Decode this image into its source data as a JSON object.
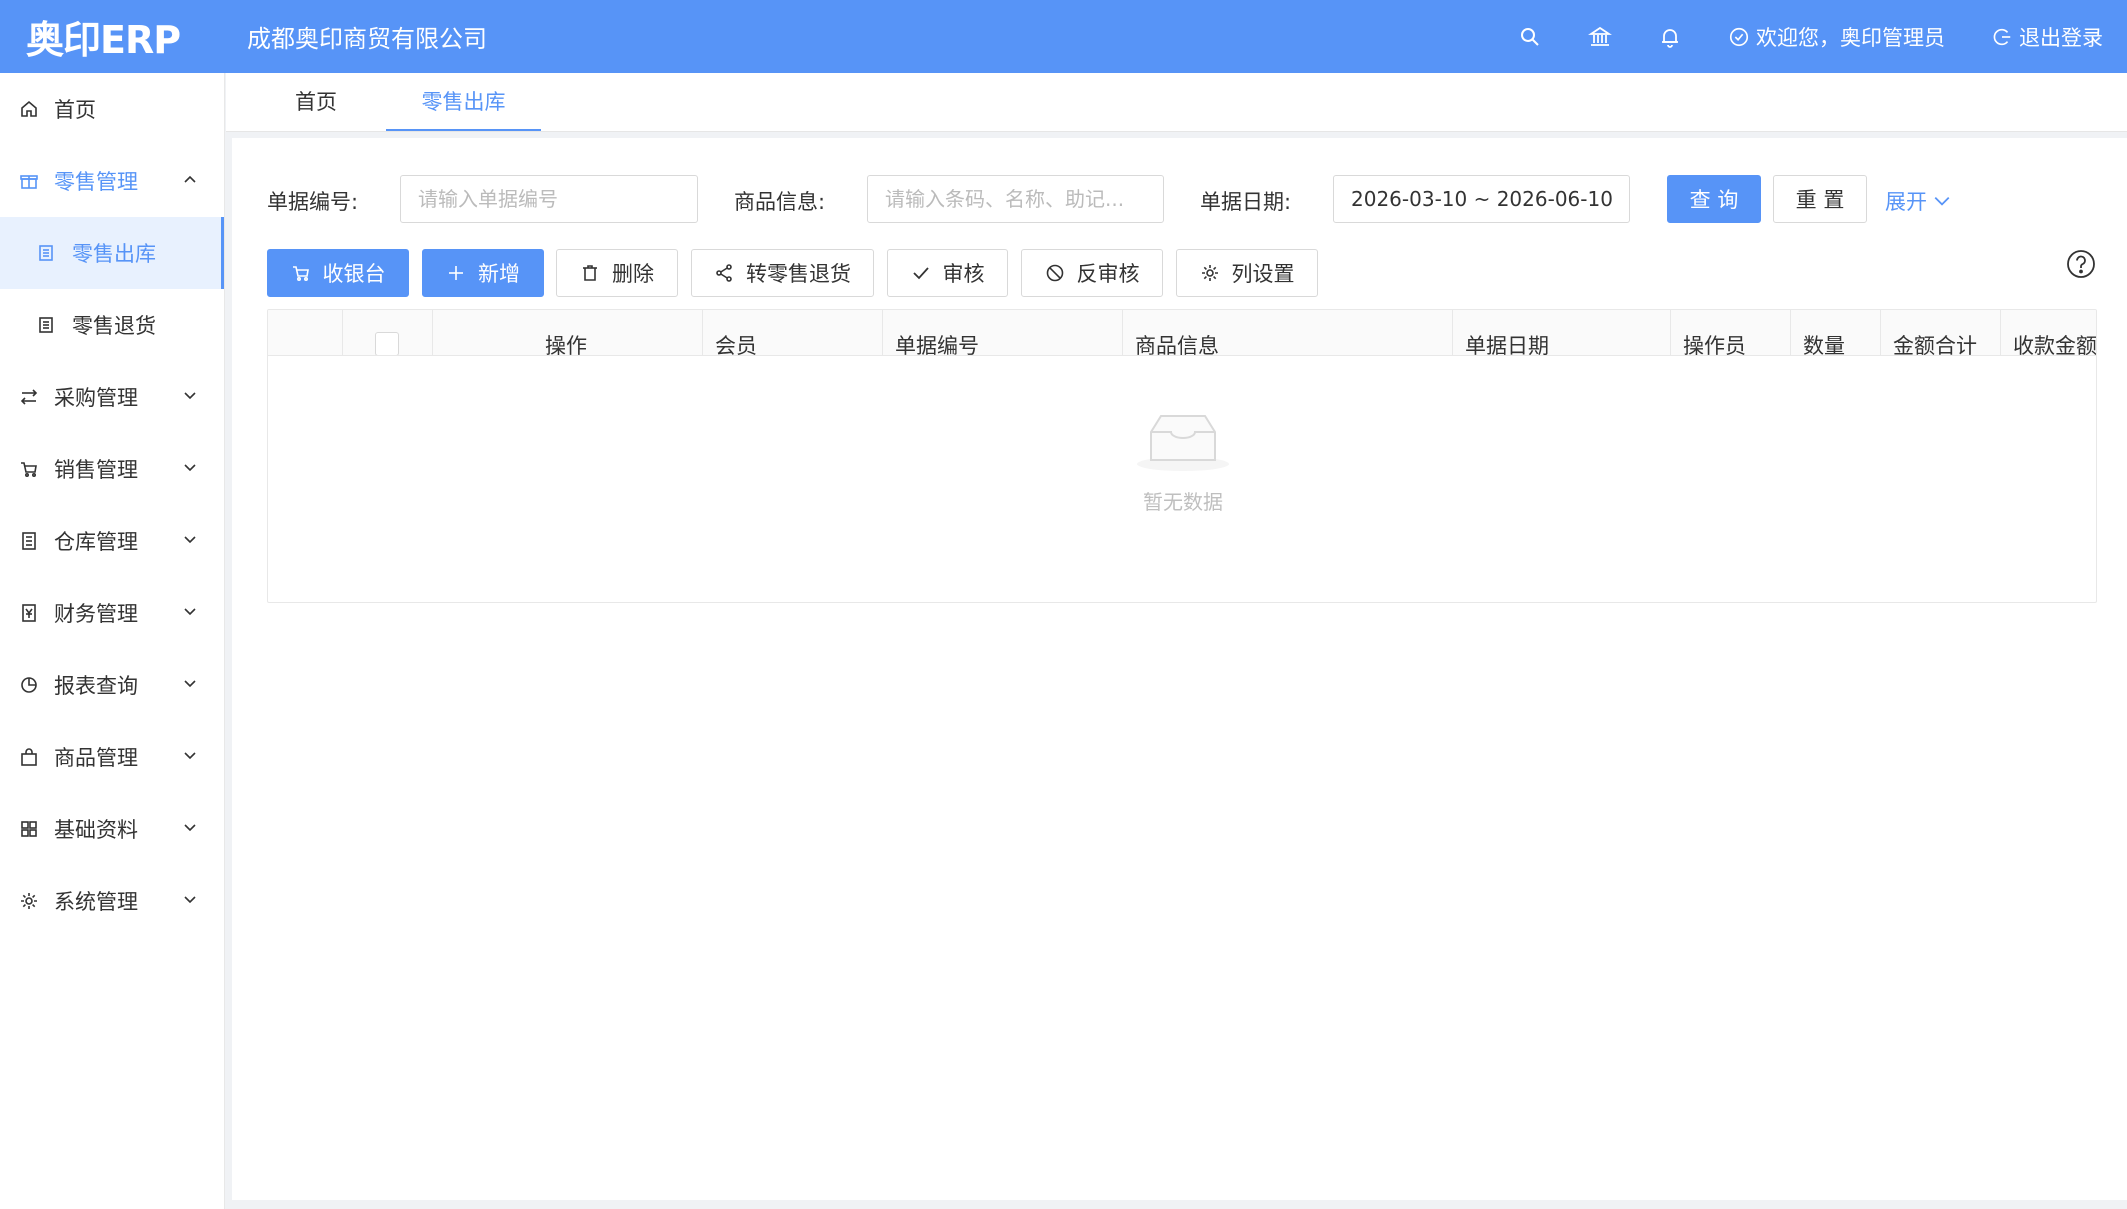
{
  "header": {
    "logo": "奥印ERP",
    "company": "成都奥印商贸有限公司",
    "welcome": "欢迎您，奥印管理员",
    "logout": "退出登录",
    "icons": [
      "search-icon",
      "bank-icon",
      "bell-icon"
    ]
  },
  "sidebar": {
    "items": [
      {
        "label": "首页",
        "icon": "home-icon"
      },
      {
        "label": "零售管理",
        "icon": "gift-icon",
        "expanded": true,
        "children": [
          {
            "label": "零售出库",
            "icon": "document-icon",
            "active": true
          },
          {
            "label": "零售退货",
            "icon": "document-icon"
          }
        ]
      },
      {
        "label": "采购管理",
        "icon": "swap-icon"
      },
      {
        "label": "销售管理",
        "icon": "cart-icon"
      },
      {
        "label": "仓库管理",
        "icon": "warehouse-icon"
      },
      {
        "label": "财务管理",
        "icon": "finance-icon"
      },
      {
        "label": "报表查询",
        "icon": "pie-chart-icon"
      },
      {
        "label": "商品管理",
        "icon": "bag-icon"
      },
      {
        "label": "基础资料",
        "icon": "grid-icon"
      },
      {
        "label": "系统管理",
        "icon": "gear-icon"
      }
    ]
  },
  "tabs": [
    {
      "label": "首页"
    },
    {
      "label": "零售出库",
      "active": true
    }
  ],
  "search": {
    "bill_no_label": "单据编号:",
    "bill_no_placeholder": "请输入单据编号",
    "goods_label": "商品信息:",
    "goods_placeholder": "请输入条码、名称、助记...",
    "date_label": "单据日期:",
    "date_value": "2026-03-10 ~ 2026-06-10",
    "query_button": "查 询",
    "reset_button": "重 置",
    "expand_link": "展开"
  },
  "toolbar": {
    "cashier": "收银台",
    "add": "新增",
    "delete": "删除",
    "to_return": "转零售退货",
    "audit": "审核",
    "unaudit": "反审核",
    "columns": "列设置"
  },
  "table": {
    "columns": [
      "操作",
      "会员",
      "单据编号",
      "商品信息",
      "单据日期",
      "操作员",
      "数量",
      "金额合计",
      "收款金额"
    ],
    "rows": [],
    "empty_text": "暂无数据"
  }
}
